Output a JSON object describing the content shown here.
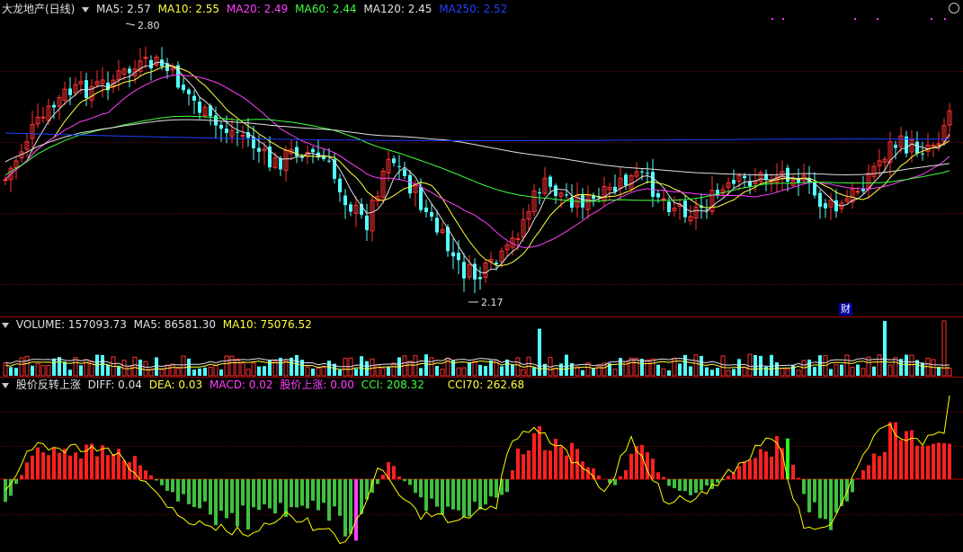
{
  "main": {
    "stock_name": "大龙地产(日线)",
    "ma": [
      {
        "label": "MA5: 2.57",
        "color": "#e0e0e0"
      },
      {
        "label": "MA10: 2.55",
        "color": "#ffff40"
      },
      {
        "label": "MA20: 2.49",
        "color": "#ff40ff"
      },
      {
        "label": "MA60: 2.44",
        "color": "#40ff40"
      },
      {
        "label": "MA120: 2.45",
        "color": "#e0e0e0"
      },
      {
        "label": "MA250: 2.52",
        "color": "#2040ff"
      }
    ],
    "high_label": "2.80",
    "low_label": "2.17",
    "caibao_badge": "财"
  },
  "volume": {
    "title": "VOLUME: 157093.73",
    "ma5": "MA5: 86581.30",
    "ma10": "MA10: 75076.52"
  },
  "indicator": {
    "name": "股价反转上涨",
    "diff": "DIFF: 0.04",
    "dea": "DEA: 0.03",
    "macd": "MACD: 0.02",
    "up": "股价上涨: 0.00",
    "cci": "CCI: 208.32",
    "cci70": "CCI70: 262.68"
  },
  "colors": {
    "up": "#ff3232",
    "down": "#54ffff",
    "bar_up": "#ff2020",
    "bar_down": "#40c040",
    "ma5": "#e0e0e0",
    "ma10": "#ffff40",
    "ma20": "#ff40ff",
    "ma60": "#40ff40",
    "ma120": "#e0e0e0",
    "ma250": "#2040ff",
    "cci_line": "#ffff00",
    "magenta_bar": "#ff40ff",
    "green_bar": "#20ff20"
  },
  "icons": {
    "collapse": "triangle-down-icon",
    "close": "close-circle-icon"
  }
}
